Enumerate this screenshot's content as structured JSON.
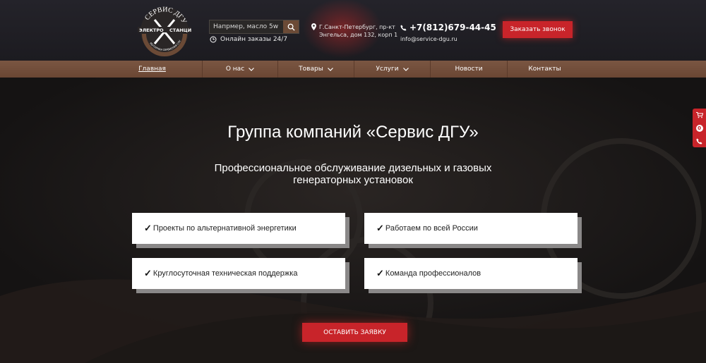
{
  "header": {
    "logo_text_top": "СЕРВИС ДГУ",
    "logo_text_left": "ЭЛЕКТРО",
    "logo_text_right": "СТАНЦИИ",
    "logo_text_bottom": "МОТОРНАЯ СЕРВИСНАЯ СЛУЖБА",
    "search_placeholder": "Напрмер, масло 5w 40",
    "online_orders": "Онлайн заказы 24/7",
    "address_line1": "Г.Санкт-Петербург, пр-кт",
    "address_line2": "Энгельса, дом 132, корп 1",
    "phone": "+7(812)679-44-45",
    "email": "info@service-dgu.ru",
    "call_button": "Заказать звонок"
  },
  "nav": {
    "items": [
      {
        "label": "Главная"
      },
      {
        "label": "О нас"
      },
      {
        "label": "Товары"
      },
      {
        "label": "Услуги"
      },
      {
        "label": "Новости"
      },
      {
        "label": "Контакты"
      }
    ]
  },
  "hero": {
    "title": "Группа компаний «Сервис ДГУ»",
    "subtitle_line1": "Профессиональное обслуживание дизельных и газовых",
    "subtitle_line2": "генераторных установок",
    "features": [
      "Проекты по альтернативной энергетики",
      "Работаем по всей России",
      "Круглосуточная техническая поддержка",
      "Команда профессионалов"
    ],
    "cta_button": "ОСТАВИТЬ ЗАЯВКУ"
  },
  "side_widget": {
    "cart_count": "0"
  },
  "colors": {
    "accent_red": "#c8242a",
    "nav_brown": "#6a4634",
    "dark_bg": "#141212"
  }
}
